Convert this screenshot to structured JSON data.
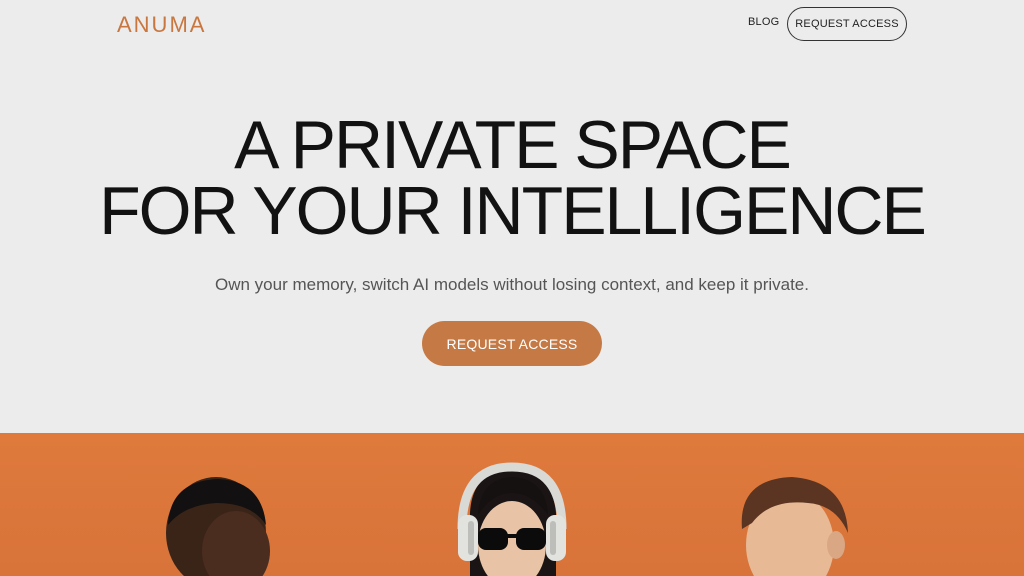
{
  "header": {
    "logo": "ANUMA",
    "nav": {
      "blog_label": "BLOG",
      "cta_label": "REQUEST ACCESS"
    }
  },
  "hero": {
    "title_line1": "A PRIVATE SPACE",
    "title_line2": "FOR YOUR INTELLIGENCE",
    "subtitle": "Own your memory, switch AI models without losing context, and keep it private.",
    "cta_label": "REQUEST ACCESS"
  },
  "colors": {
    "background": "#ececec",
    "brand": "#c9773f",
    "cta_fill": "#c57a45",
    "photo_band": "#df7a3c"
  }
}
